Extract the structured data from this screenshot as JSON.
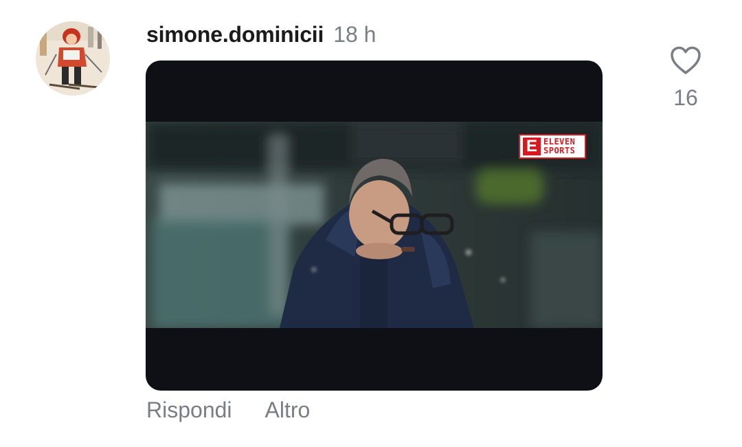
{
  "comment": {
    "username": "simone.dominicii",
    "timestamp": "18 h",
    "avatar_icon": "user-avatar-photo",
    "media": {
      "badge_mark": "E",
      "badge_line1": "ELEVEN",
      "badge_line2": "SPORTS"
    },
    "like": {
      "icon": "heart-outline-icon",
      "count": "16"
    },
    "actions": {
      "reply_label": "Rispondi",
      "more_label": "Altro"
    }
  },
  "colors": {
    "username": "#1b1b1b",
    "secondary_text": "#7a7d85",
    "media_background": "#0f1015",
    "badge_red": "#d71921"
  }
}
